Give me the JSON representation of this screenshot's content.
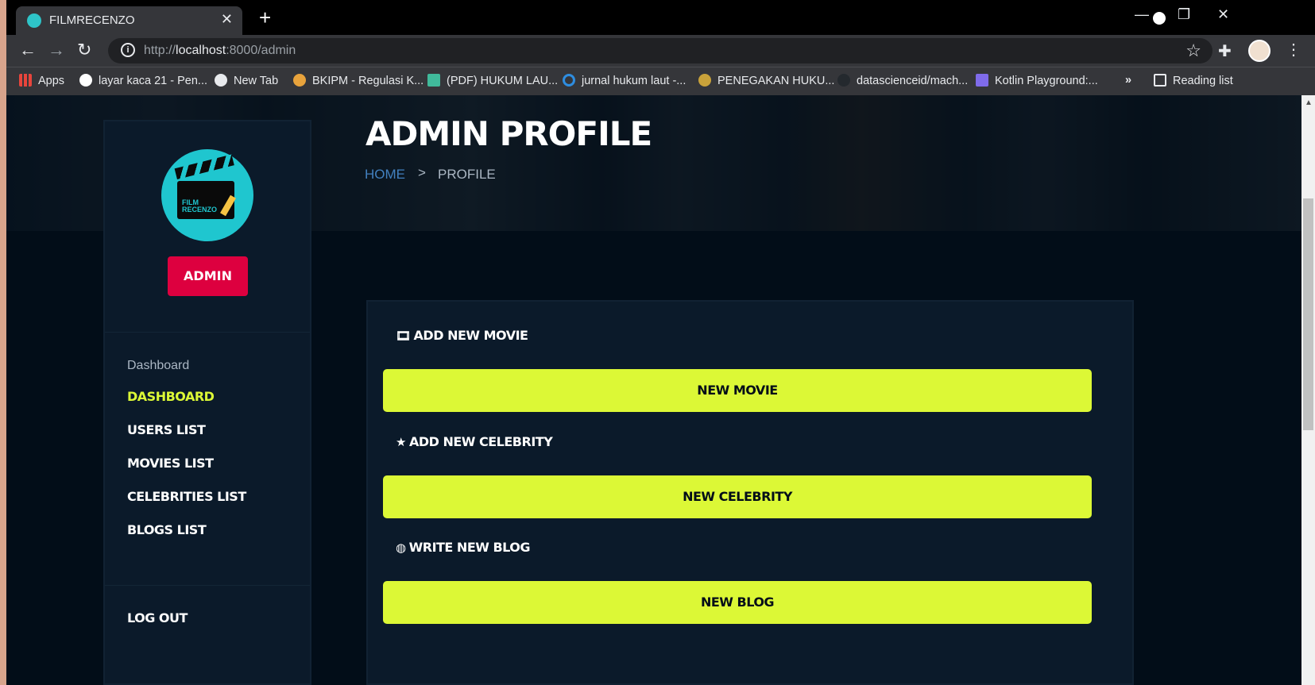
{
  "browser": {
    "tab_title": "FILMRECENZO",
    "tab_close": "✕",
    "new_tab": "+",
    "url_prefix": "http://",
    "url_host": "localhost",
    "url_rest": ":8000/admin",
    "win_minimize": "—",
    "win_restore": "❐",
    "win_close": "✕"
  },
  "bookmarks": [
    {
      "label": "Apps",
      "icon": "apps-grid-icon",
      "color": "#e8453c"
    },
    {
      "label": "layar kaca 21 - Pen...",
      "icon": "google-icon",
      "color": "#ffffff"
    },
    {
      "label": "New Tab",
      "icon": "globe-icon",
      "color": "#e8eaed"
    },
    {
      "label": "BKIPM - Regulasi K...",
      "icon": "bkipm-icon",
      "color": "#e8a33c"
    },
    {
      "label": "(PDF) HUKUM LAU...",
      "icon": "researchgate-icon",
      "color": "#40ba9b"
    },
    {
      "label": "jurnal hukum laut -...",
      "icon": "jurnal-icon",
      "color": "#2e8de0"
    },
    {
      "label": "PENEGAKAN HUKU...",
      "icon": "penegakan-icon",
      "color": "#c9a23a"
    },
    {
      "label": "datascienceid/mach...",
      "icon": "github-icon",
      "color": "#24292e"
    },
    {
      "label": "Kotlin Playground:...",
      "icon": "kotlin-icon",
      "color": "#7f6bea"
    }
  ],
  "bookmarks_more": "»",
  "reading_list": "Reading list",
  "hero": {
    "title": "ADMIN PROFILE",
    "breadcrumb_home": "HOME",
    "breadcrumb_sep": ">",
    "breadcrumb_current": "PROFILE"
  },
  "sidebar": {
    "role_badge": "ADMIN",
    "heading": "Dashboard",
    "links": [
      {
        "label": "DASHBOARD",
        "active": true
      },
      {
        "label": "USERS LIST",
        "active": false
      },
      {
        "label": "MOVIES LIST",
        "active": false
      },
      {
        "label": "CELEBRITIES LIST",
        "active": false
      },
      {
        "label": "BLOGS LIST",
        "active": false
      }
    ],
    "logout": "LOG OUT",
    "logo_text": "FILM RECENZO"
  },
  "main": {
    "sections": [
      {
        "title": "ADD NEW MOVIE",
        "icon": "film-icon",
        "button": "NEW MOVIE"
      },
      {
        "title": "ADD NEW CELEBRITY",
        "icon": "star-icon",
        "button": "NEW CELEBRITY"
      },
      {
        "title": "WRITE NEW BLOG",
        "icon": "globe-icon",
        "button": "NEW BLOG"
      }
    ]
  },
  "colors": {
    "accent": "#dcf836",
    "badge": "#dd003f",
    "background": "#020d18",
    "link": "#4280bf"
  }
}
